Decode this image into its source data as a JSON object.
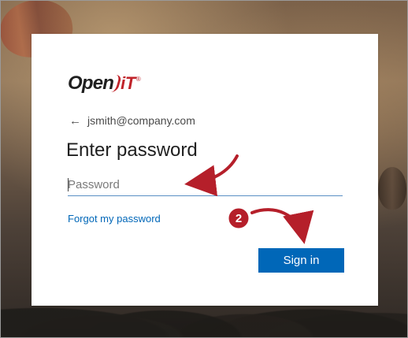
{
  "brand": {
    "logo_text": "Open",
    "logo_it": "iT",
    "logo_reg": "®"
  },
  "account": {
    "back_icon": "←",
    "email": "jsmith@company.com"
  },
  "form": {
    "title": "Enter password",
    "password_placeholder": "Password",
    "forgot_link": "Forgot my password",
    "sign_in_label": "Sign in"
  },
  "annotation": {
    "step_number": "2"
  },
  "colors": {
    "accent": "#0067b8",
    "annotation": "#b51f2a"
  }
}
